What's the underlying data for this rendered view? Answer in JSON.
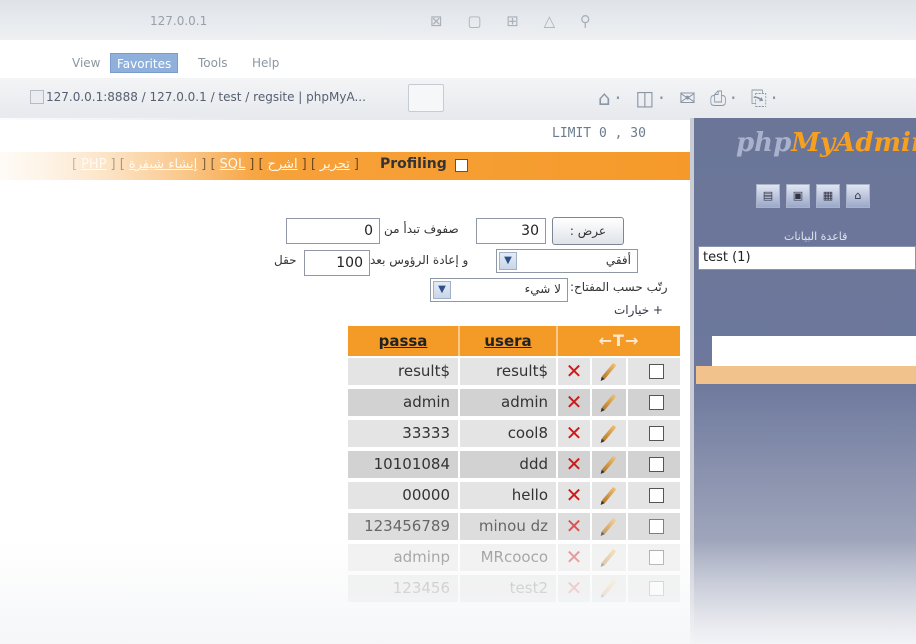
{
  "window": {
    "title": "127.0.0.1"
  },
  "menubar": {
    "items": [
      "View",
      "Favorites",
      "Tools",
      "Help"
    ]
  },
  "tab": {
    "title": "127.0.0.1:8888 / 127.0.0.1 / test / regsite | phpMyA..."
  },
  "query": {
    "limit": "LIMIT 0 , 30"
  },
  "toolbar": {
    "profiling_label": "Profiling",
    "links": [
      "PHP",
      "إنشاء شيفرة",
      "SQL",
      "اشرح",
      "تحرير"
    ]
  },
  "nav_form": {
    "show_button": "عرض :",
    "rows_value": "30",
    "rows_from_label": "صفوف تبدأ من",
    "start_value": "0",
    "mode_value": "أفقي",
    "repeat_label": "و إعادة الرؤوس بعد",
    "repeat_value": "100",
    "cells_label": "حقل",
    "sort_label": "رتّب حسب المفتاح:",
    "sort_value": "لا شيء",
    "options_link": "+ خيارات"
  },
  "table": {
    "columns": [
      "passa",
      "usera"
    ],
    "arrows": "←T→",
    "rows": [
      {
        "passa": "result$",
        "usera": "result$"
      },
      {
        "passa": "admin",
        "usera": "admin"
      },
      {
        "passa": "33333",
        "usera": "cool8"
      },
      {
        "passa": "10101084",
        "usera": "ddd"
      },
      {
        "passa": "00000",
        "usera": "hello"
      },
      {
        "passa": "123456789",
        "usera": "minou dz"
      },
      {
        "passa": "adminp",
        "usera": "MRcooco"
      },
      {
        "passa": "123456",
        "usera": "test2"
      }
    ]
  },
  "sidebar": {
    "logo_php": "php",
    "logo_myadmin": "MyAdmin",
    "db_label": "قاعدة البيانات",
    "db_value": "test (1)"
  },
  "icons": {
    "delete": "close-icon",
    "edit": "pencil-icon",
    "home": "home-icon"
  },
  "colors": {
    "accent_orange": "#f59a2a",
    "sidebar_blue": "#6a7598",
    "delete_red": "#cc1a1a"
  }
}
